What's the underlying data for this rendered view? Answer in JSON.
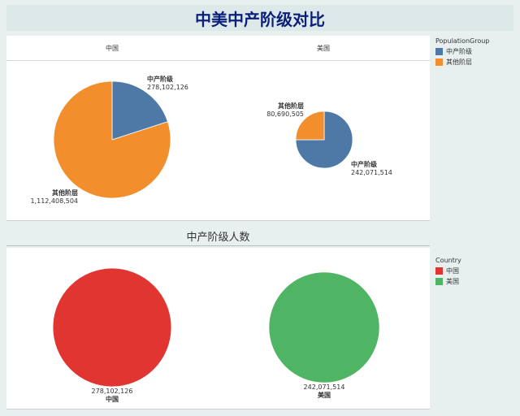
{
  "title": "中美中产阶级对比",
  "top_panel": {
    "columns": [
      "中国",
      "美国"
    ]
  },
  "bottom_section": {
    "title": "中产阶级人数"
  },
  "legend_population": {
    "title": "PopulationGroup",
    "items": [
      {
        "label": "中产阶级",
        "color": "#4e79a7"
      },
      {
        "label": "其他阶层",
        "color": "#f28e2b"
      }
    ]
  },
  "legend_country": {
    "title": "Country",
    "items": [
      {
        "label": "中国",
        "color": "#e03530"
      },
      {
        "label": "美国",
        "color": "#4fb565"
      }
    ]
  },
  "chart_data": [
    {
      "type": "pie",
      "facet": "中国",
      "slices": [
        {
          "label": "中产阶级",
          "value": 278102126,
          "display": "278,102,126",
          "color": "#4e79a7"
        },
        {
          "label": "其他阶层",
          "value": 1112408504,
          "display": "1,112,408,504",
          "color": "#f28e2b"
        }
      ]
    },
    {
      "type": "pie",
      "facet": "美国",
      "slices": [
        {
          "label": "中产阶级",
          "value": 242071514,
          "display": "242,071,514",
          "color": "#4e79a7"
        },
        {
          "label": "其他阶层",
          "value": 80690505,
          "display": "80,690,505",
          "color": "#f28e2b"
        }
      ]
    },
    {
      "type": "bubble",
      "title": "中产阶级人数",
      "points": [
        {
          "label": "中国",
          "value": 278102126,
          "display": "278,102,126",
          "color": "#e03530"
        },
        {
          "label": "美国",
          "value": 242071514,
          "display": "242,071,514",
          "color": "#4fb565"
        }
      ]
    }
  ]
}
